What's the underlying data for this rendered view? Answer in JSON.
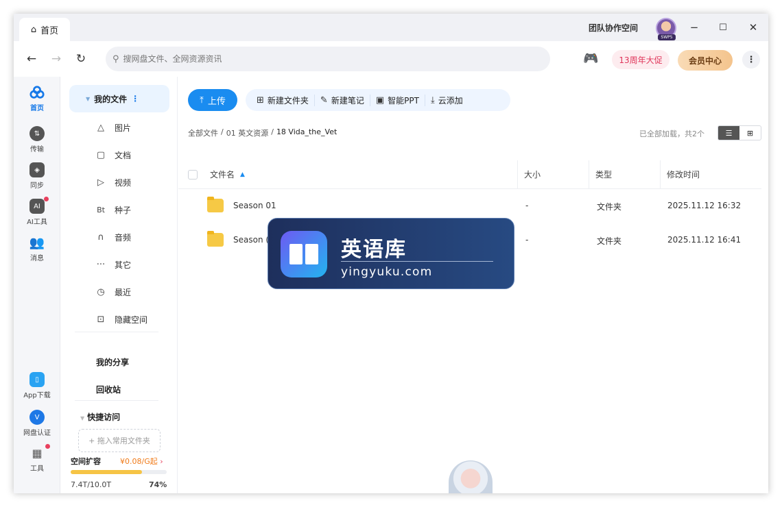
{
  "titlebar": {
    "tab_label": "首页",
    "team_space": "团队协作空间",
    "avatar_tag": "SWP5"
  },
  "navbar": {
    "search_placeholder": "搜网盘文件、全网资源资讯",
    "promo_label": "13周年大促",
    "vip_label": "会员中心"
  },
  "rail": {
    "items": [
      {
        "label": "首页"
      },
      {
        "label": "传输"
      },
      {
        "label": "同步"
      },
      {
        "label": "AI工具"
      },
      {
        "label": "消息"
      },
      {
        "label": "App下载"
      },
      {
        "label": "网盘认证"
      },
      {
        "label": "工具"
      }
    ]
  },
  "sidebar": {
    "my_files": "我的文件",
    "categories": [
      {
        "label": "图片",
        "icon": "image-icon"
      },
      {
        "label": "文档",
        "icon": "document-icon"
      },
      {
        "label": "视频",
        "icon": "video-icon"
      },
      {
        "label": "种子",
        "icon": "torrent-icon"
      },
      {
        "label": "音频",
        "icon": "audio-icon"
      },
      {
        "label": "其它",
        "icon": "more-dots-icon"
      },
      {
        "label": "最近",
        "icon": "recent-icon"
      },
      {
        "label": "隐藏空间",
        "icon": "lock-icon"
      }
    ],
    "my_share": "我的分享",
    "recycle": "回收站",
    "quick_access": "快捷访问",
    "drop_hint": "+ 拖入常用文件夹",
    "capacity_title": "空间扩容",
    "capacity_price": "¥0.08/G起",
    "capacity_used": "7.4T/10.0T",
    "capacity_percent": "74%",
    "capacity_fraction": 0.74
  },
  "toolbar": {
    "upload": "上传",
    "new_folder": "新建文件夹",
    "new_note": "新建笔记",
    "smart_ppt": "智能PPT",
    "cloud_add": "云添加"
  },
  "breadcrumb": {
    "root": "全部文件",
    "sep": "/",
    "level1": "01 英文资源",
    "current": "18 Vida_the_Vet"
  },
  "status": {
    "loaded": "已全部加载，共2个"
  },
  "table": {
    "headers": {
      "name": "文件名",
      "size": "大小",
      "type": "类型",
      "modified": "修改时间"
    },
    "rows": [
      {
        "name": "Season 01",
        "size": "-",
        "type": "文件夹",
        "modified": "2025.11.12 16:32"
      },
      {
        "name": "Season (",
        "size": "-",
        "type": "文件夹",
        "modified": "2025.11.12 16:41"
      }
    ]
  },
  "overlay": {
    "title": "英语库",
    "subtitle": "yingyuku.com"
  },
  "colors": {
    "accent": "#1a8cf0",
    "promo": "#e0365b",
    "price": "#f07a18",
    "capacity_bar": "#f6c445"
  }
}
